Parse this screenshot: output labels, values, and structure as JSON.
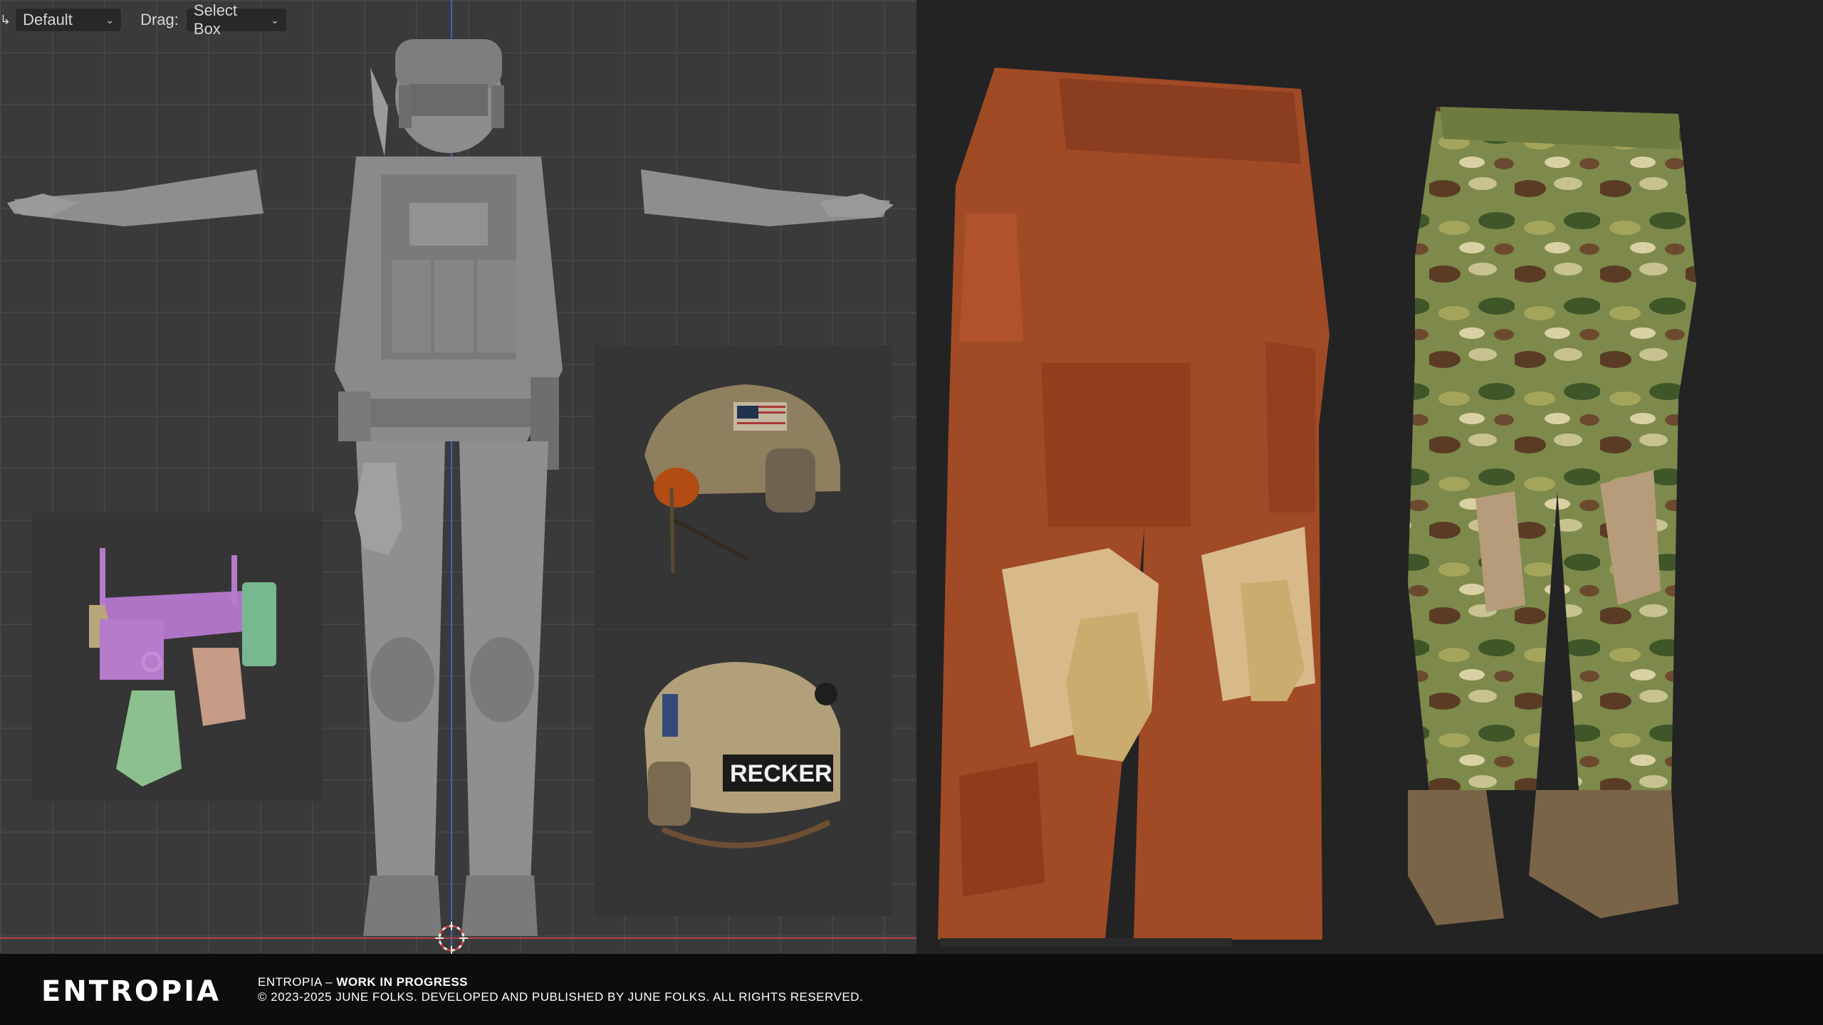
{
  "toolbar": {
    "orientation_value": "Default",
    "drag_label": "Drag:",
    "drag_value": "Select Box"
  },
  "helmet_patch": "RECKER",
  "footer": {
    "logo": "ENTROPIA",
    "title_prefix": "ENTROPIA – ",
    "title_status": "WORK IN PROGRESS",
    "copyright": "© 2023-2025 JUNE FOLKS. DEVELOPED AND PUBLISHED BY JUNE FOLKS. ALL RIGHTS RESERVED."
  },
  "colors": {
    "viewport_bg": "#3a3a3a",
    "grid": "#454545",
    "axis_y": "#3d63c0",
    "axis_x": "#b84444",
    "pants_brown": "#a04a26",
    "camo_base": "#7d8a4c",
    "footer_bg": "#0d0d0d"
  },
  "icons": [
    "chevron-down-icon",
    "arrow-icon",
    "3d-cursor-icon"
  ]
}
